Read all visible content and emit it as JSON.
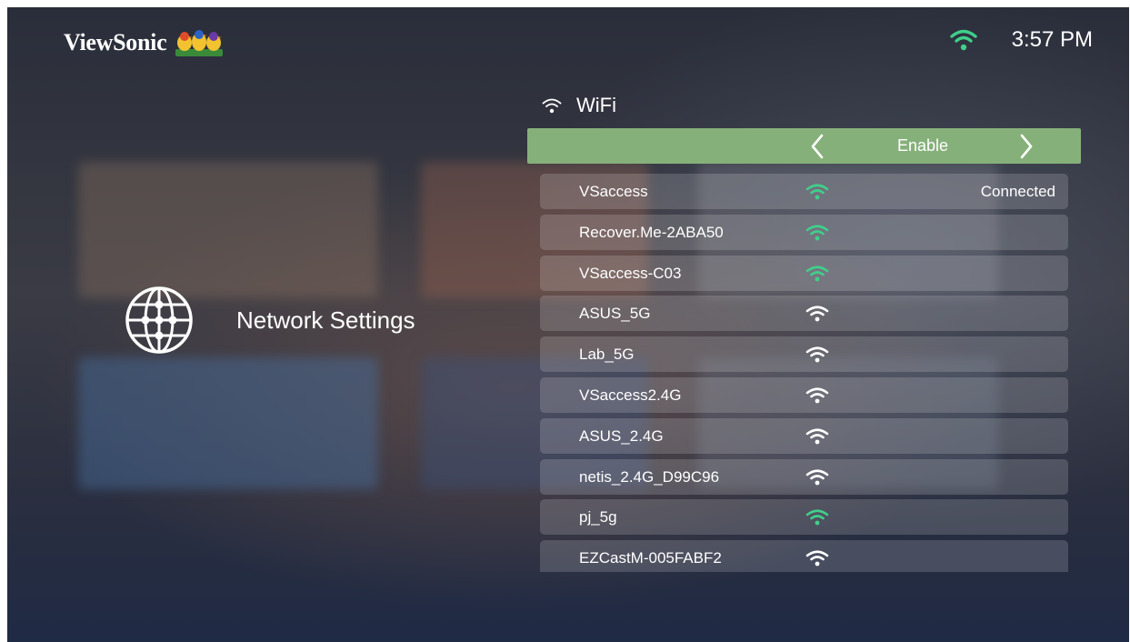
{
  "brand": {
    "name": "ViewSonic"
  },
  "status_bar": {
    "time": "3:57 PM",
    "wifi_color": "#3fd08a"
  },
  "section": {
    "title": "Network Settings"
  },
  "wifi": {
    "label": "WiFi",
    "toggle": {
      "value": "Enable",
      "bar_color": "#86b07a"
    },
    "networks": [
      {
        "name": "VSaccess",
        "status": "Connected",
        "signal": "strong"
      },
      {
        "name": "Recover.Me-2ABA50",
        "status": "",
        "signal": "strong"
      },
      {
        "name": "VSaccess-C03",
        "status": "",
        "signal": "strong"
      },
      {
        "name": "ASUS_5G",
        "status": "",
        "signal": "medium"
      },
      {
        "name": "Lab_5G",
        "status": "",
        "signal": "medium"
      },
      {
        "name": "VSaccess2.4G",
        "status": "",
        "signal": "medium"
      },
      {
        "name": "ASUS_2.4G",
        "status": "",
        "signal": "medium"
      },
      {
        "name": "netis_2.4G_D99C96",
        "status": "",
        "signal": "medium"
      },
      {
        "name": "pj_5g",
        "status": "",
        "signal": "strong"
      },
      {
        "name": "EZCastM-005FABF2",
        "status": "",
        "signal": "medium"
      }
    ]
  }
}
